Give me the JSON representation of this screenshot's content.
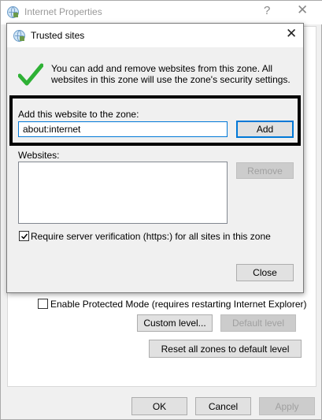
{
  "background_window": {
    "title": "Internet Properties",
    "help_glyph": "?",
    "close_glyph": "✕",
    "protected_mode_label": "Enable Protected Mode (requires restarting Internet Explorer)",
    "custom_level_label": "Custom level...",
    "default_level_label": "Default level",
    "reset_all_label": "Reset all zones to default level",
    "ok_label": "OK",
    "cancel_label": "Cancel",
    "apply_label": "Apply"
  },
  "dialog": {
    "title": "Trusted sites",
    "close_glyph": "✕",
    "info_text": "You can add and remove websites from this zone. All websites in this zone will use the zone's security settings.",
    "add_label": "Add this website to the zone:",
    "url_value": "about:internet",
    "add_button": "Add",
    "websites_label": "Websites:",
    "remove_button": "Remove",
    "require_https_label": "Require server verification (https:) for all sites in this zone",
    "require_https_checked": true,
    "close_button": "Close"
  },
  "icons": {
    "app_icon": "internet-globe-icon",
    "info_icon": "green-checkmark-icon"
  },
  "colors": {
    "accent": "#0078d7",
    "checkmark": "#2eb135",
    "window_bg": "#f0f0f0"
  }
}
